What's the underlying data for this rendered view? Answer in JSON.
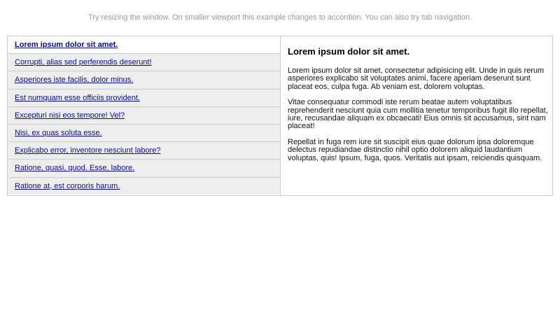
{
  "hint": "Try resizing the window. On smaller viewport this example changes to accordion. You can also try tab navigation.",
  "tabs": [
    {
      "label": "Lorem ipsum dolor sit amet.",
      "active": true
    },
    {
      "label": "Corrupti, alias sed perferendis deserunt!"
    },
    {
      "label": "Asperiores iste facilis, dolor minus."
    },
    {
      "label": "Est numquam esse officiis provident."
    },
    {
      "label": "Excepturi nisi eos tempore! Vel?"
    },
    {
      "label": "Nisi, ex quas soluta esse."
    },
    {
      "label": "Explicabo error, inventore nesciunt labore?"
    },
    {
      "label": "Ratione, quasi, quod. Esse, labore."
    },
    {
      "label": "Ratione at, est corporis harum."
    }
  ],
  "panel": {
    "title": "Lorem ipsum dolor sit amet.",
    "paragraphs": [
      "Lorem ipsum dolor sit amet, consectetur adipisicing elit. Unde in quis rerum asperiores explicabo sit voluptates animi, facere aperiam deserunt sunt placeat eos, culpa fuga. Ab veniam est, dolorem voluptas.",
      "Vitae consequatur commodi iste rerum beatae autem voluptatibus reprehenderit nesciunt quia cum mollitia tenetur temporibus fugit illo repellat, iure, recusandae aliquam ex obcaecati! Eius omnis sit accusamus, sint nam placeat!",
      "Repellat in fuga rem iure sit suscipit eius quae dolorum ipsa doloremque delectus repudiandae distinctio nihil optio dolorem aliquid laudantium voluptas, quis! Ipsum, fuga, quos. Veritatis aut ipsam, reiciendis quisquam."
    ]
  }
}
